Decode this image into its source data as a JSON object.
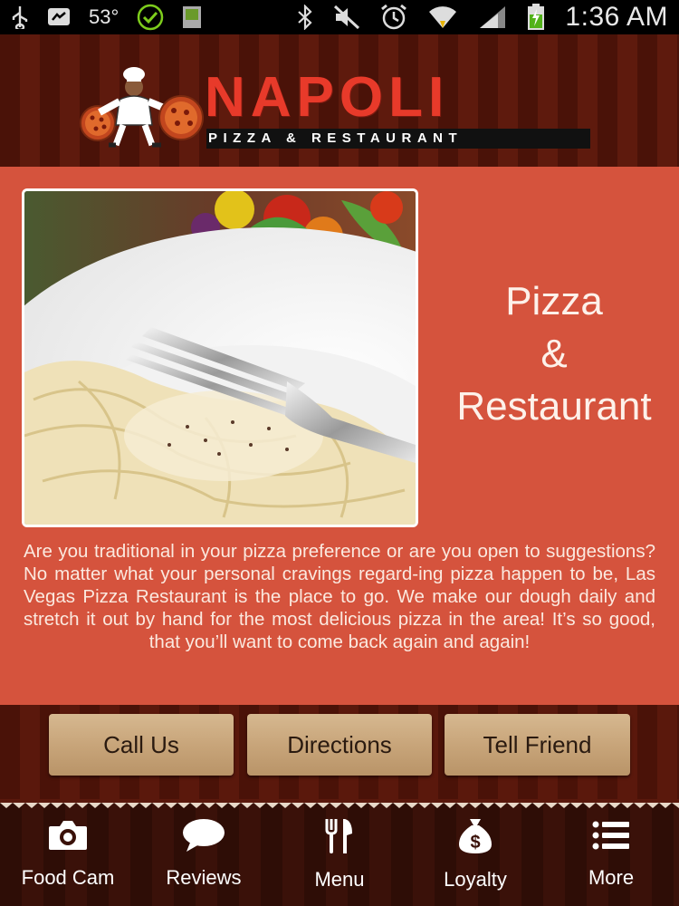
{
  "status_bar": {
    "temperature": "53°",
    "time": "1:36 AM"
  },
  "header": {
    "brand": "NAPOLI",
    "tagline": "PIZZA & RESTAURANT"
  },
  "hero": {
    "title_line1": "Pizza",
    "title_line2": "&",
    "title_line3": "Restaurant",
    "description": "Are you traditional in your pizza preference or are you open to suggestions? No matter what your personal cravings regard-ing pizza happen to be, Las Vegas Pizza Restaurant is the place to go. We make our dough daily and stretch it out by hand for the most delicious pizza in the area! It’s so good, that you’ll want to come back again and again!"
  },
  "actions": {
    "call_label": "Call Us",
    "directions_label": "Directions",
    "tell_friend_label": "Tell Friend"
  },
  "nav": {
    "items": [
      {
        "label": "Food Cam",
        "icon": "camera-icon"
      },
      {
        "label": "Reviews",
        "icon": "speech-bubble-icon"
      },
      {
        "label": "Menu",
        "icon": "fork-knife-icon"
      },
      {
        "label": "Loyalty",
        "icon": "money-bag-icon"
      },
      {
        "label": "More",
        "icon": "list-icon"
      }
    ]
  },
  "colors": {
    "accent_red": "#e83a2a",
    "content_orange": "#d5533d",
    "button_tan": "#c8a57a"
  }
}
